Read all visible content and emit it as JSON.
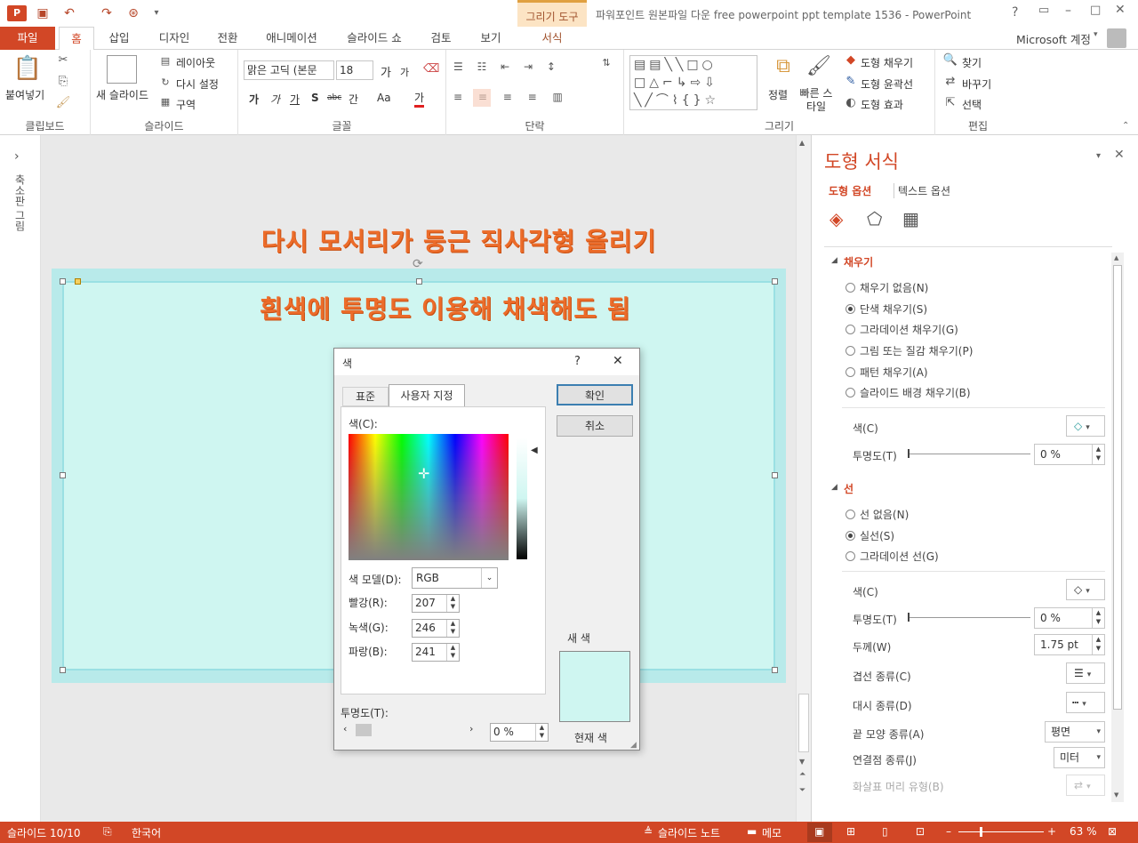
{
  "window": {
    "title": "파워포인트 원본파일 다운 free powerpoint ppt template 1536 - PowerPoint",
    "help": "?",
    "context_group": "그리기 도구",
    "account": "Microsoft 계정"
  },
  "tabs": [
    "파일",
    "홈",
    "삽입",
    "디자인",
    "전환",
    "애니메이션",
    "슬라이드 쇼",
    "검토",
    "보기",
    "서식"
  ],
  "ribbon": {
    "clipboard": {
      "label": "클립보드",
      "paste": "붙여넣기"
    },
    "slides": {
      "label": "슬라이드",
      "new_slide": "새 슬라이드",
      "layout": "레이아웃",
      "reset": "다시 설정",
      "section": "구역"
    },
    "font": {
      "label": "글꼴",
      "font_name": "맑은 고딕 (본문",
      "font_size": "18",
      "grow": "가",
      "shrink": "가",
      "bold": "가",
      "italic": "가",
      "underline": "가",
      "shadow": "S",
      "strike": "abc",
      "spacing": "간",
      "case": "Aa",
      "color": "가"
    },
    "paragraph": {
      "label": "단락"
    },
    "drawing": {
      "label": "그리기",
      "arrange": "정렬",
      "quick_styles": "빠른 스타일",
      "fill": "도형 채우기",
      "outline": "도형 윤곽선",
      "effects": "도형 효과"
    },
    "editing": {
      "label": "편집",
      "find": "찾기",
      "replace": "바꾸기",
      "select": "선택"
    }
  },
  "left_pane": {
    "expand": "›",
    "label": "축소판 그림"
  },
  "slide": {
    "heading1": "다시 모서리가 둥근 직사각형 올리기",
    "heading2": "흰색에 투명도 이용해 채색해도 됨"
  },
  "dialog": {
    "title": "색",
    "help": "?",
    "close": "✕",
    "tab_standard": "표준",
    "tab_custom": "사용자 지정",
    "colors_label": "색(C):",
    "model_label": "색 모델(D):",
    "model_value": "RGB",
    "red_label": "빨강(R):",
    "red": "207",
    "green_label": "녹색(G):",
    "green": "246",
    "blue_label": "파랑(B):",
    "blue": "241",
    "transparency_label": "투명도(T):",
    "transparency": "0 %",
    "ok": "확인",
    "cancel": "취소",
    "new_label": "새 색",
    "current_label": "현재 색",
    "new_color": "#cff6f1"
  },
  "format_pane": {
    "title": "도형 서식",
    "close": "✕",
    "tab_shape": "도형 옵션",
    "tab_text": "텍스트 옵션",
    "fill_section": "채우기",
    "fill_options": [
      "채우기 없음(N)",
      "단색 채우기(S)",
      "그라데이션 채우기(G)",
      "그림 또는 질감 채우기(P)",
      "패턴 채우기(A)",
      "슬라이드 배경 채우기(B)"
    ],
    "fill_selected": 1,
    "fill_color_label": "색(C)",
    "fill_transparency_label": "투명도(T)",
    "fill_transparency": "0 %",
    "line_section": "선",
    "line_options": [
      "선 없음(N)",
      "실선(S)",
      "그라데이션 선(G)"
    ],
    "line_selected": 1,
    "line_color_label": "색(C)",
    "line_transparency_label": "투명도(T)",
    "line_transparency": "0 %",
    "width_label": "두께(W)",
    "width": "1.75 pt",
    "compound_label": "겹선 종류(C)",
    "dash_label": "대시 종류(D)",
    "cap_label": "끝 모양 종류(A)",
    "cap": "평면",
    "join_label": "연결점 종류(J)",
    "join": "미터",
    "arrow_label": "화살표 머리 유형(B)"
  },
  "status": {
    "slide": "슬라이드 10/10",
    "language": "한국어",
    "notes": "슬라이드 노트",
    "comments": "메모",
    "zoom": "63 %"
  },
  "colors": {
    "accent": "#d24726",
    "shape_fill": "#cff6f1",
    "title_orange": "#ec6c2a"
  }
}
